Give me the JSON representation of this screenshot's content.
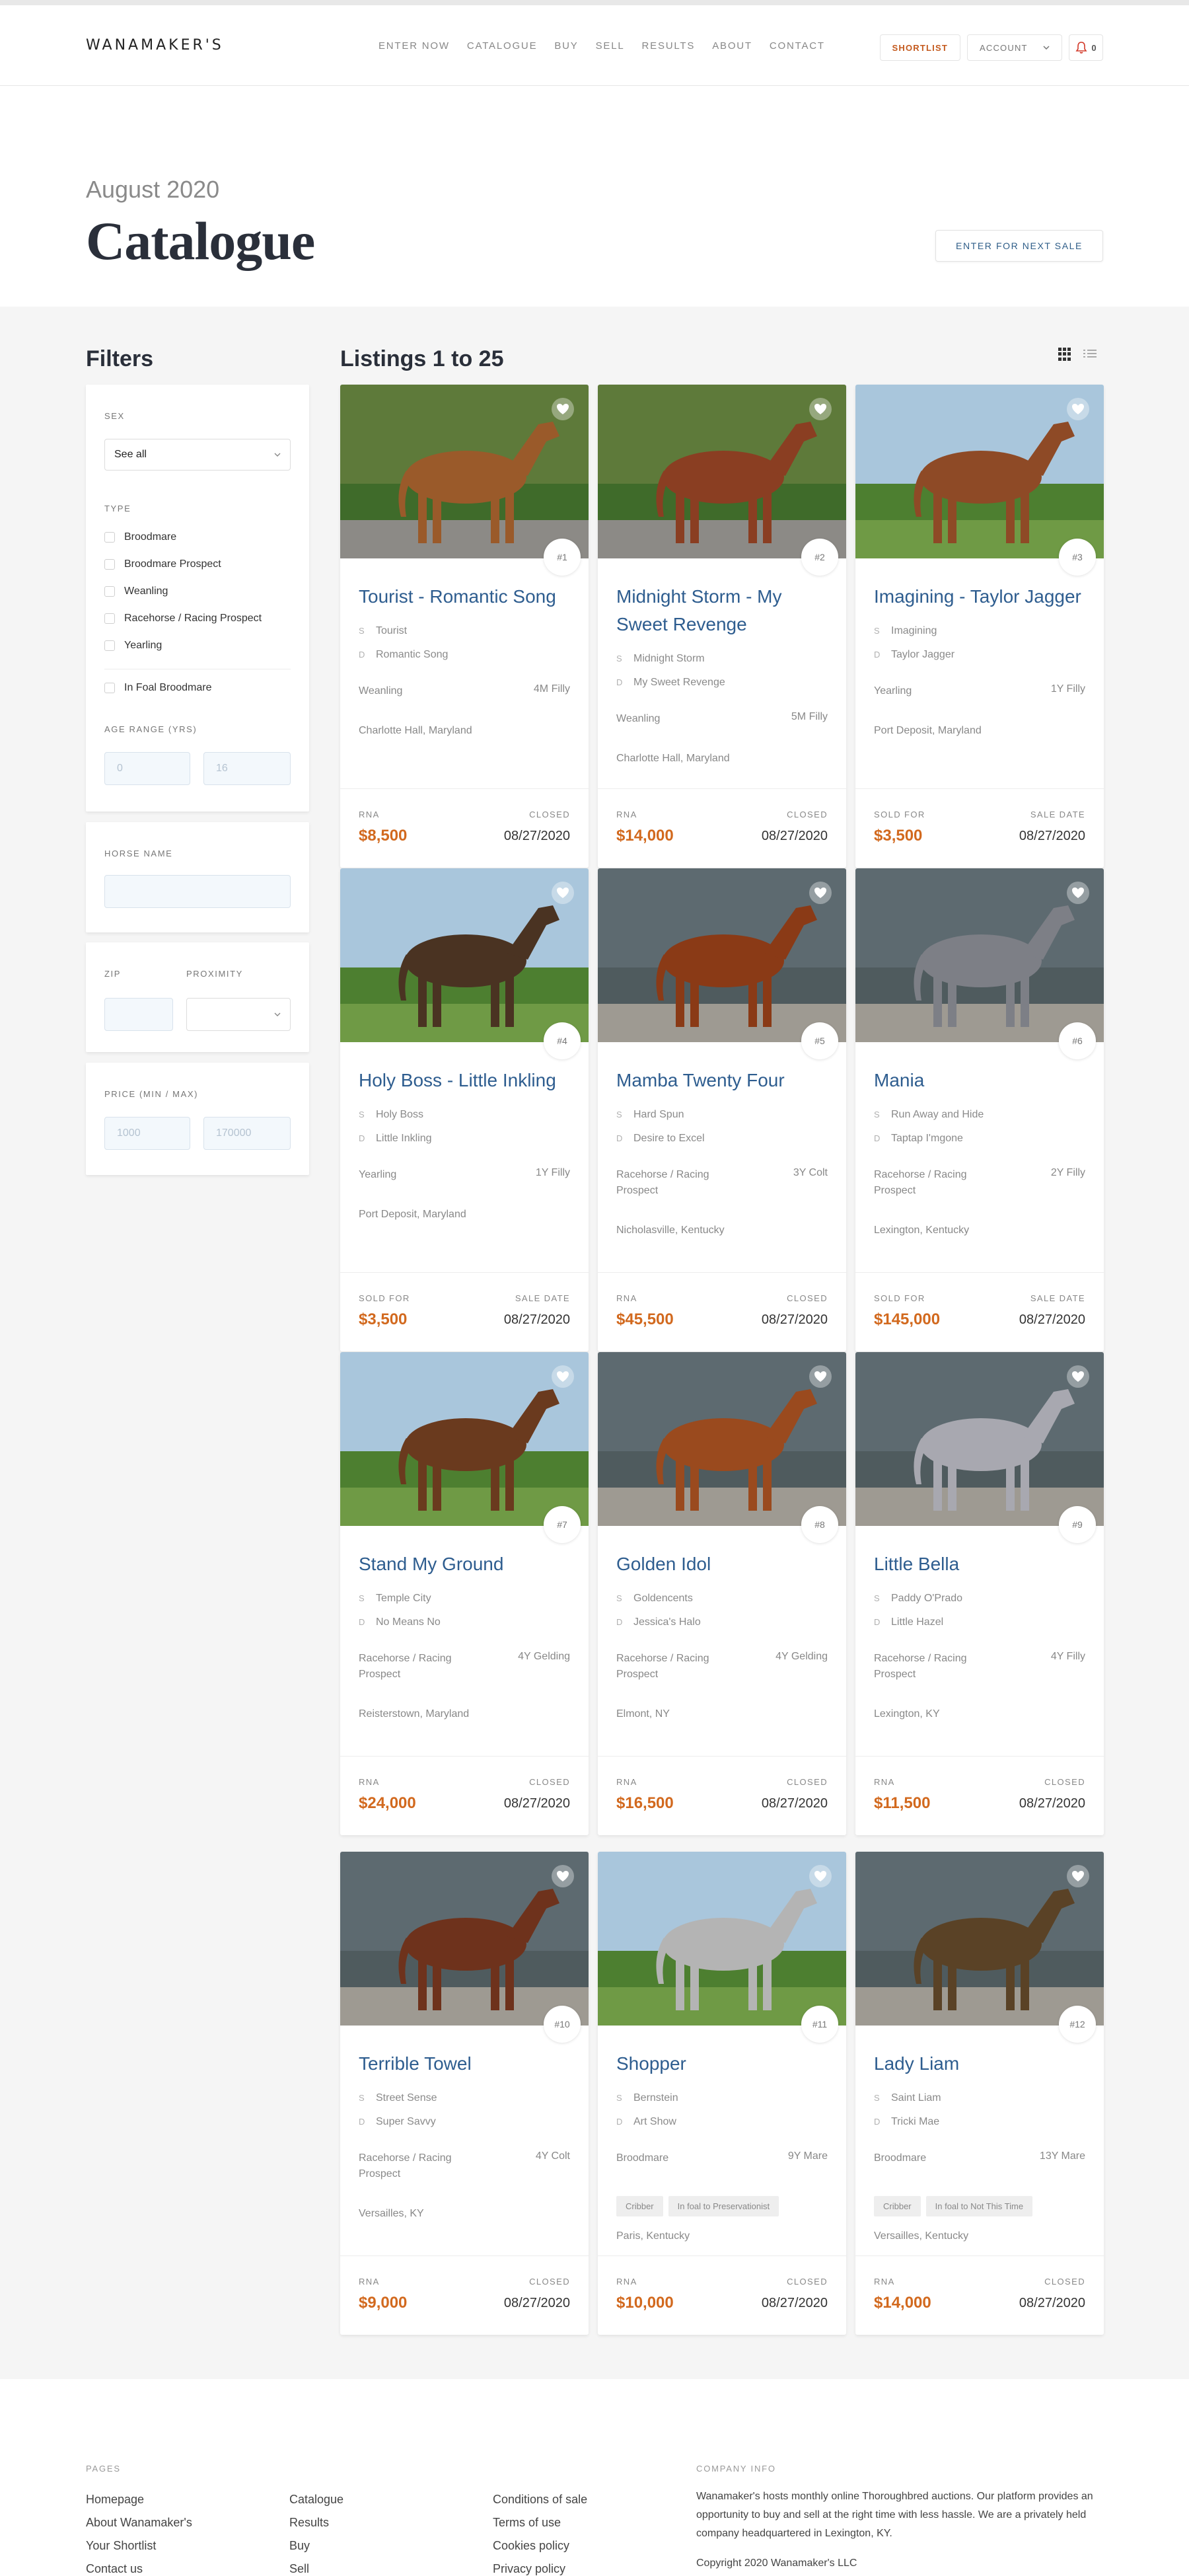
{
  "header": {
    "logo": "WANAMAKER'S",
    "nav": [
      "ENTER NOW",
      "CATALOGUE",
      "BUY",
      "SELL",
      "RESULTS",
      "ABOUT",
      "CONTACT"
    ],
    "shortlist_label": "SHORTLIST",
    "account_label": "ACCOUNT",
    "notif_count": "0"
  },
  "hero": {
    "subtitle": "August 2020",
    "title": "Catalogue",
    "enter_button": "ENTER FOR NEXT SALE"
  },
  "filters": {
    "title": "Filters",
    "sex_label": "SEX",
    "sex_value": "See all",
    "type_label": "TYPE",
    "types": [
      "Broodmare",
      "Broodmare Prospect",
      "Weanling",
      "Racehorse / Racing Prospect",
      "Yearling"
    ],
    "in_foal_label": "In Foal Broodmare",
    "age_label": "AGE RANGE (YRS)",
    "age_min": "0",
    "age_max": "16",
    "horse_name_label": "HORSE NAME",
    "zip_label": "ZIP",
    "proximity_label": "PROXIMITY",
    "price_label": "PRICE (MIN / MAX)",
    "price_min": "1000",
    "price_max": "170000"
  },
  "listings": {
    "title": "Listings 1 to 25",
    "cards": [
      {
        "num": "#1",
        "title": "Tourist - Romantic Song",
        "sire": "Tourist",
        "dam": "Romantic Song",
        "type": "Weanling",
        "age": "4M Filly",
        "location": "Charlotte Hall, Maryland",
        "tags": [],
        "status": "RNA",
        "date_label": "CLOSED",
        "price": "$8,500",
        "date": "08/27/2020",
        "coat": "#9a5a2a",
        "bg": "green"
      },
      {
        "num": "#2",
        "title": "Midnight Storm - My Sweet Revenge",
        "sire": "Midnight Storm",
        "dam": "My Sweet Revenge",
        "type": "Weanling",
        "age": "5M Filly",
        "location": "Charlotte Hall, Maryland",
        "tags": [],
        "status": "RNA",
        "date_label": "CLOSED",
        "price": "$14,000",
        "date": "08/27/2020",
        "coat": "#8a3e22",
        "bg": "green"
      },
      {
        "num": "#3",
        "title": "Imagining - Taylor Jagger",
        "sire": "Imagining",
        "dam": "Taylor Jagger",
        "type": "Yearling",
        "age": "1Y Filly",
        "location": "Port Deposit, Maryland",
        "tags": [],
        "status": "SOLD FOR",
        "date_label": "SALE DATE",
        "price": "$3,500",
        "date": "08/27/2020",
        "coat": "#8e4a26",
        "bg": "field"
      },
      {
        "num": "#4",
        "title": "Holy Boss - Little Inkling",
        "sire": "Holy Boss",
        "dam": "Little Inkling",
        "type": "Yearling",
        "age": "1Y Filly",
        "location": "Port Deposit, Maryland",
        "tags": [],
        "status": "SOLD FOR",
        "date_label": "SALE DATE",
        "price": "$3,500",
        "date": "08/27/2020",
        "coat": "#4a3322",
        "bg": "field"
      },
      {
        "num": "#5",
        "title": "Mamba Twenty Four",
        "sire": "Hard Spun",
        "dam": "Desire to Excel",
        "type": "Racehorse / Racing Prospect",
        "age": "3Y Colt",
        "location": "Nicholasville, Kentucky",
        "tags": [],
        "status": "RNA",
        "date_label": "CLOSED",
        "price": "$45,500",
        "date": "08/27/2020",
        "coat": "#8a3a16",
        "bg": "barn"
      },
      {
        "num": "#6",
        "title": "Mania",
        "sire": "Run Away and Hide",
        "dam": "Taptap I'mgone",
        "type": "Racehorse / Racing Prospect",
        "age": "2Y Filly",
        "location": "Lexington, Kentucky",
        "tags": [],
        "status": "SOLD FOR",
        "date_label": "SALE DATE",
        "price": "$145,000",
        "date": "08/27/2020",
        "coat": "#7d7f86",
        "bg": "barn"
      },
      {
        "num": "#7",
        "title": "Stand My Ground",
        "sire": "Temple City",
        "dam": "No Means No",
        "type": "Racehorse / Racing Prospect",
        "age": "4Y Gelding",
        "location": "Reisterstown, Maryland",
        "tags": [],
        "status": "RNA",
        "date_label": "CLOSED",
        "price": "$24,000",
        "date": "08/27/2020",
        "coat": "#6a3a1e",
        "bg": "field"
      },
      {
        "num": "#8",
        "title": "Golden Idol",
        "sire": "Goldencents",
        "dam": "Jessica's Halo",
        "type": "Racehorse / Racing Prospect",
        "age": "4Y Gelding",
        "location": "Elmont, NY",
        "tags": [],
        "status": "RNA",
        "date_label": "CLOSED",
        "price": "$16,500",
        "date": "08/27/2020",
        "coat": "#9a4a1e",
        "bg": "barn"
      },
      {
        "num": "#9",
        "title": "Little Bella",
        "sire": "Paddy O'Prado",
        "dam": "Little Hazel",
        "type": "Racehorse / Racing Prospect",
        "age": "4Y Filly",
        "location": "Lexington, KY",
        "tags": [],
        "status": "RNA",
        "date_label": "CLOSED",
        "price": "$11,500",
        "date": "08/27/2020",
        "coat": "#a8a8b0",
        "bg": "barn"
      },
      {
        "num": "#10",
        "title": "Terrible Towel",
        "sire": "Street Sense",
        "dam": "Super Savvy",
        "type": "Racehorse / Racing Prospect",
        "age": "4Y Colt",
        "location": "Versailles, KY",
        "tags": [],
        "status": "RNA",
        "date_label": "CLOSED",
        "price": "$9,000",
        "date": "08/27/2020",
        "coat": "#6e321c",
        "bg": "barn"
      },
      {
        "num": "#11",
        "title": "Shopper",
        "sire": "Bernstein",
        "dam": "Art Show",
        "type": "Broodmare",
        "age": "9Y Mare",
        "location": "Paris, Kentucky",
        "tags": [
          "Cribber",
          "In foal to Preservationist"
        ],
        "status": "RNA",
        "date_label": "CLOSED",
        "price": "$10,000",
        "date": "08/27/2020",
        "coat": "#b4b4b4",
        "bg": "field"
      },
      {
        "num": "#12",
        "title": "Lady Liam",
        "sire": "Saint Liam",
        "dam": "Tricki Mae",
        "type": "Broodmare",
        "age": "13Y Mare",
        "location": "Versailles, Kentucky",
        "tags": [
          "Cribber",
          "In foal to Not This Time"
        ],
        "status": "RNA",
        "date_label": "CLOSED",
        "price": "$14,000",
        "date": "08/27/2020",
        "coat": "#5a4226",
        "bg": "barn"
      }
    ]
  },
  "footer": {
    "pages_label": "PAGES",
    "col1": [
      "Homepage",
      "About Wanamaker's",
      "Your Shortlist",
      "Contact us"
    ],
    "col2": [
      "Catalogue",
      "Results",
      "Buy",
      "Sell"
    ],
    "col3": [
      "Conditions of sale",
      "Terms of use",
      "Cookies policy",
      "Privacy policy"
    ],
    "company_label": "COMPANY INFO",
    "about": "Wanamaker's hosts monthly online Thoroughbred auctions. Our platform provides an opportunity to buy and sell at the right time with less hassle. We are a privately held company headquartered in Lexington, KY.",
    "copyright": "Copyright 2020 Wanamaker's LLC"
  }
}
